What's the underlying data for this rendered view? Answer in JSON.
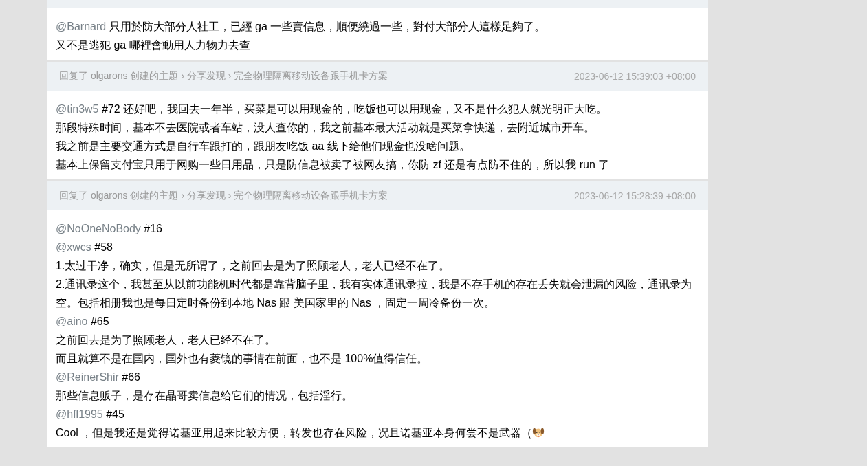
{
  "replies": [
    {
      "cut_top": true,
      "lines": [
        {
          "mention": "@Barnard",
          "text": " 只用於防大部分人社工，已經 ga 一些賣信息，順便繞過一些，對付大部分人這樣足夠了。"
        },
        {
          "text": "又不是逃犯 ga 哪裡會動用人力物力去查"
        }
      ]
    },
    {
      "header": {
        "action": "回复了 olgarons 创建的主题",
        "sep": "›",
        "node": "分享发现",
        "sep2": "›",
        "topic": "完全物理隔离移动设备跟手机卡方案",
        "time": "2023-06-12 15:39:03 +08:00"
      },
      "lines": [
        {
          "mention": "@tin3w5",
          "text": " #72 还好吧，我回去一年半，买菜是可以用现金的，吃饭也可以用现金，又不是什么犯人就光明正大吃。"
        },
        {
          "text": "那段特殊时间，基本不去医院或者车站，没人查你的，我之前基本最大活动就是买菜拿快递，去附近城市开车。"
        },
        {
          "text": "我之前是主要交通方式是自行车跟打的，跟朋友吃饭 aa 线下给他们现金也没啥问题。"
        },
        {
          "text": "基本上保留支付宝只用于网购一些日用品，只是防信息被卖了被网友搞，你防 zf 还是有点防不住的，所以我 run 了"
        }
      ]
    },
    {
      "header": {
        "action": "回复了 olgarons 创建的主题",
        "sep": "›",
        "node": "分享发现",
        "sep2": "›",
        "topic": "完全物理隔离移动设备跟手机卡方案",
        "time": "2023-06-12 15:28:39 +08:00"
      },
      "lines": [
        {
          "mention": "@NoOneNoBody",
          "text": " #16"
        },
        {
          "mention": "@xwcs",
          "text": " #58"
        },
        {
          "text": "1.太过干净，确实，但是无所谓了，之前回去是为了照顾老人，老人已经不在了。"
        },
        {
          "text": "2.通讯录这个，我甚至从以前功能机时代都是靠背脑子里，我有实体通讯录拉，我是不存手机的存在丢失就会泄漏的风险，通讯录为空。包括相册我也是每日定时备份到本地 Nas 跟 美国家里的 Nas ，固定一周冷备份一次。"
        },
        {
          "mention": "@aino",
          "text": " #65"
        },
        {
          "text": "之前回去是为了照顾老人，老人已经不在了。"
        },
        {
          "text": "而且就算不是在国内，国外也有菱镜的事情在前面，也不是 100%值得信任。"
        },
        {
          "mention": "@ReinerShir",
          "text": " #66"
        },
        {
          "text": "那些信息贩子，是存在晶哥卖信息给它们的情况，包括淫行。"
        },
        {
          "mention": "@hfl1995",
          "text": " #45"
        },
        {
          "text": "Cool ，但是我还是觉得诺基亚用起来比较方便，转发也存在风险，况且诺基亚本身何尝不是武器（",
          "trailing_icon": true
        }
      ]
    }
  ]
}
